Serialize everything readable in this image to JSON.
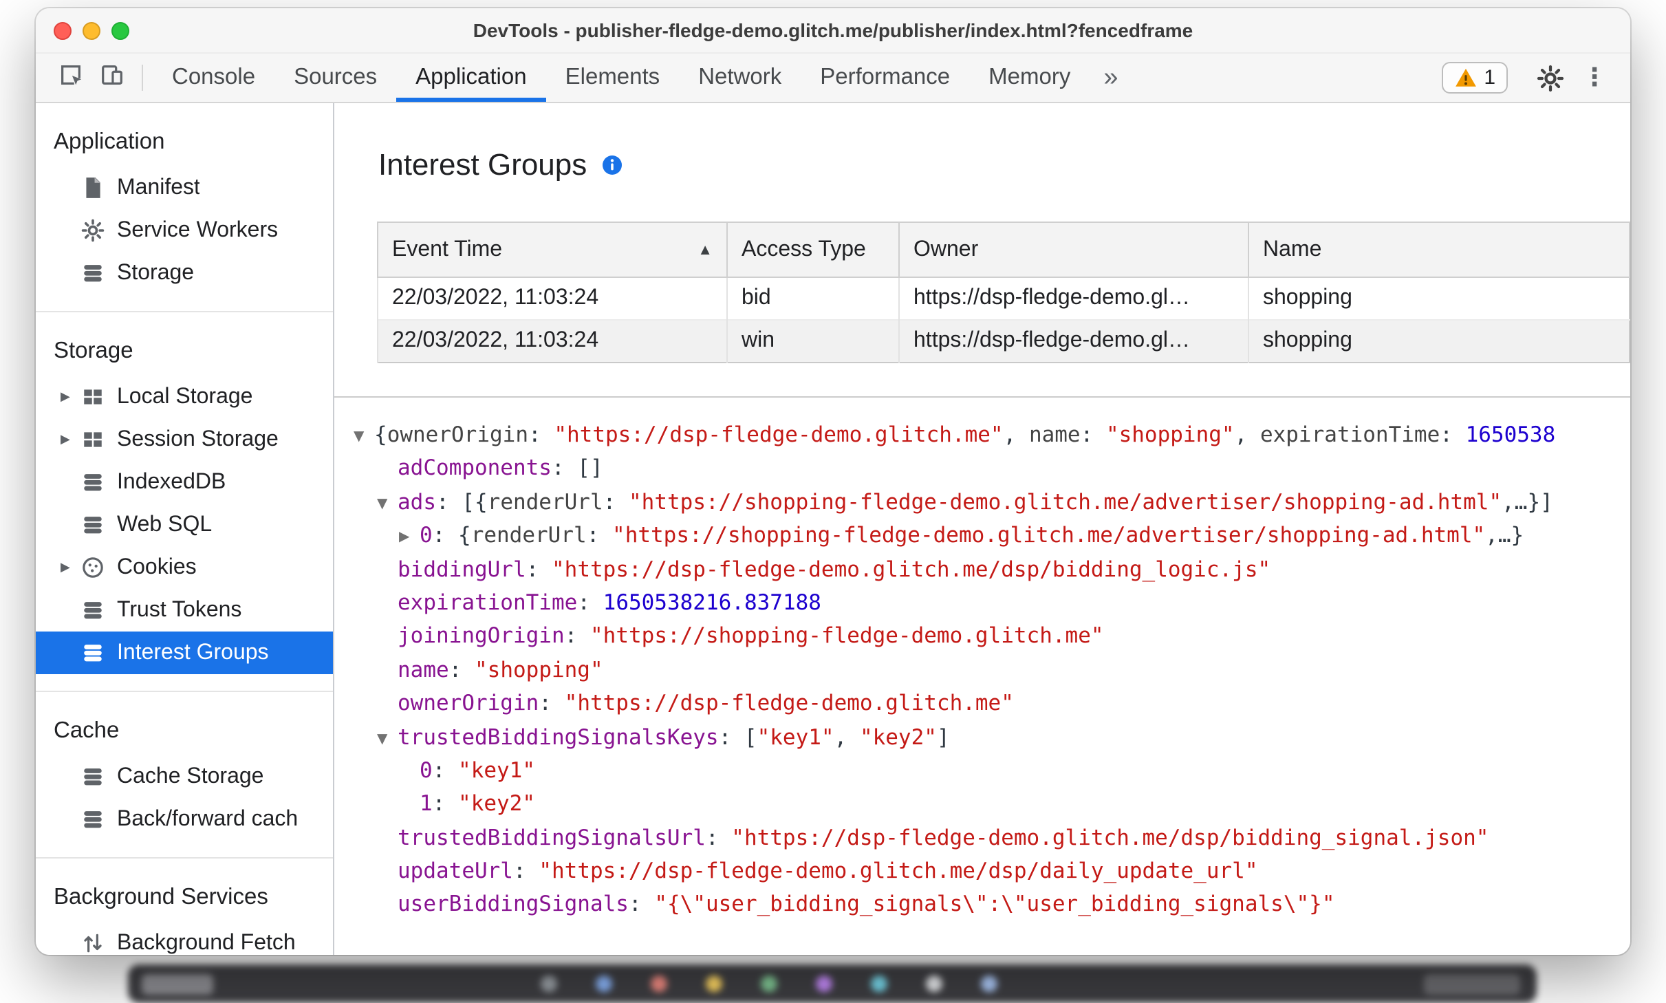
{
  "window": {
    "title": "DevTools - publisher-fledge-demo.glitch.me/publisher/index.html?fencedframe"
  },
  "toolbar": {
    "tabs": [
      {
        "label": "Console"
      },
      {
        "label": "Sources"
      },
      {
        "label": "Application",
        "active": true
      },
      {
        "label": "Elements"
      },
      {
        "label": "Network"
      },
      {
        "label": "Performance"
      },
      {
        "label": "Memory"
      }
    ],
    "more_tabs_label": "»",
    "menu_icon_glyph": "⋮",
    "warning_badge": {
      "count": "1"
    }
  },
  "sidebar": {
    "sections": [
      {
        "header": "Application",
        "items": [
          {
            "label": "Manifest",
            "icon": "file"
          },
          {
            "label": "Service Workers",
            "icon": "gear"
          },
          {
            "label": "Storage",
            "icon": "database"
          }
        ]
      },
      {
        "header": "Storage",
        "items": [
          {
            "label": "Local Storage",
            "icon": "table",
            "expandable": true
          },
          {
            "label": "Session Storage",
            "icon": "table",
            "expandable": true
          },
          {
            "label": "IndexedDB",
            "icon": "database"
          },
          {
            "label": "Web SQL",
            "icon": "database"
          },
          {
            "label": "Cookies",
            "icon": "cookie",
            "expandable": true
          },
          {
            "label": "Trust Tokens",
            "icon": "database"
          },
          {
            "label": "Interest Groups",
            "icon": "database",
            "selected": true
          }
        ]
      },
      {
        "header": "Cache",
        "items": [
          {
            "label": "Cache Storage",
            "icon": "database"
          },
          {
            "label": "Back/forward cach",
            "icon": "database"
          }
        ]
      },
      {
        "header": "Background Services",
        "items": [
          {
            "label": "Background Fetch",
            "icon": "fetch"
          }
        ]
      }
    ]
  },
  "main": {
    "heading": "Interest Groups",
    "table": {
      "columns": [
        "Event Time",
        "Access Type",
        "Owner",
        "Name"
      ],
      "sort": {
        "column": "Event Time",
        "direction": "asc"
      },
      "rows": [
        [
          "22/03/2022, 11:03:24",
          "bid",
          "https://dsp-fledge-demo.gl…",
          "shopping"
        ],
        [
          "22/03/2022, 11:03:24",
          "win",
          "https://dsp-fledge-demo.gl…",
          "shopping"
        ]
      ]
    },
    "tree": {
      "lines": [
        {
          "level": 0,
          "arrow": "down",
          "segments": [
            [
              "p",
              "{"
            ],
            [
              "pk",
              "ownerOrigin"
            ],
            [
              "p",
              ": "
            ],
            [
              "s",
              "\"https://dsp-fledge-demo.glitch.me\""
            ],
            [
              "p",
              ", "
            ],
            [
              "pk",
              "name"
            ],
            [
              "p",
              ": "
            ],
            [
              "s",
              "\"shopping\""
            ],
            [
              "p",
              ", "
            ],
            [
              "pk",
              "expirationTime"
            ],
            [
              "p",
              ": "
            ],
            [
              "n",
              "1650538"
            ]
          ]
        },
        {
          "level": 1,
          "segments": [
            [
              "k",
              "adComponents"
            ],
            [
              "p",
              ": []"
            ]
          ]
        },
        {
          "level": 1,
          "arrow": "down",
          "segments": [
            [
              "k",
              "ads"
            ],
            [
              "p",
              ": [{"
            ],
            [
              "pk",
              "renderUrl"
            ],
            [
              "p",
              ": "
            ],
            [
              "s",
              "\"https://shopping-fledge-demo.glitch.me/advertiser/shopping-ad.html\""
            ],
            [
              "p",
              ",…}]"
            ]
          ]
        },
        {
          "level": 2,
          "arrow": "right",
          "segments": [
            [
              "k",
              "0"
            ],
            [
              "p",
              ": {"
            ],
            [
              "pk",
              "renderUrl"
            ],
            [
              "p",
              ": "
            ],
            [
              "s",
              "\"https://shopping-fledge-demo.glitch.me/advertiser/shopping-ad.html\""
            ],
            [
              "p",
              ",…}"
            ]
          ]
        },
        {
          "level": 1,
          "segments": [
            [
              "k",
              "biddingUrl"
            ],
            [
              "p",
              ": "
            ],
            [
              "s",
              "\"https://dsp-fledge-demo.glitch.me/dsp/bidding_logic.js\""
            ]
          ]
        },
        {
          "level": 1,
          "segments": [
            [
              "k",
              "expirationTime"
            ],
            [
              "p",
              ": "
            ],
            [
              "n",
              "1650538216.837188"
            ]
          ]
        },
        {
          "level": 1,
          "segments": [
            [
              "k",
              "joiningOrigin"
            ],
            [
              "p",
              ": "
            ],
            [
              "s",
              "\"https://shopping-fledge-demo.glitch.me\""
            ]
          ]
        },
        {
          "level": 1,
          "segments": [
            [
              "k",
              "name"
            ],
            [
              "p",
              ": "
            ],
            [
              "s",
              "\"shopping\""
            ]
          ]
        },
        {
          "level": 1,
          "segments": [
            [
              "k",
              "ownerOrigin"
            ],
            [
              "p",
              ": "
            ],
            [
              "s",
              "\"https://dsp-fledge-demo.glitch.me\""
            ]
          ]
        },
        {
          "level": 1,
          "arrow": "down",
          "segments": [
            [
              "k",
              "trustedBiddingSignalsKeys"
            ],
            [
              "p",
              ": ["
            ],
            [
              "s",
              "\"key1\""
            ],
            [
              "p",
              ", "
            ],
            [
              "s",
              "\"key2\""
            ],
            [
              "p",
              "]"
            ]
          ]
        },
        {
          "level": 2,
          "segments": [
            [
              "k",
              "0"
            ],
            [
              "p",
              ": "
            ],
            [
              "s",
              "\"key1\""
            ]
          ]
        },
        {
          "level": 2,
          "segments": [
            [
              "k",
              "1"
            ],
            [
              "p",
              ": "
            ],
            [
              "s",
              "\"key2\""
            ]
          ]
        },
        {
          "level": 1,
          "segments": [
            [
              "k",
              "trustedBiddingSignalsUrl"
            ],
            [
              "p",
              ": "
            ],
            [
              "s",
              "\"https://dsp-fledge-demo.glitch.me/dsp/bidding_signal.json\""
            ]
          ]
        },
        {
          "level": 1,
          "segments": [
            [
              "k",
              "updateUrl"
            ],
            [
              "p",
              ": "
            ],
            [
              "s",
              "\"https://dsp-fledge-demo.glitch.me/dsp/daily_update_url\""
            ]
          ]
        },
        {
          "level": 1,
          "segments": [
            [
              "k",
              "userBiddingSignals"
            ],
            [
              "p",
              ": "
            ],
            [
              "s",
              "\"{\\\"user_bidding_signals\\\":\\\"user_bidding_signals\\\"}\""
            ]
          ]
        }
      ]
    }
  },
  "colors": {
    "accent": "#1a73e8",
    "selected_bg": "#1a73e8",
    "json_key": "#881391",
    "json_string": "#c41a16",
    "json_number": "#1c00cf",
    "warning": "#f29900"
  }
}
